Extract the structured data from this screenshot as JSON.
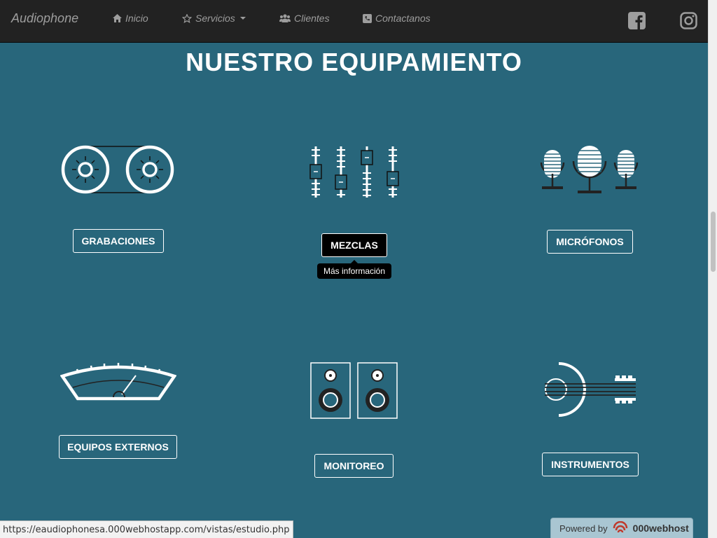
{
  "nav": {
    "brand": "Audiophone",
    "items": [
      {
        "label": "Inicio",
        "icon": "home-icon"
      },
      {
        "label": "Servicios",
        "icon": "star-icon"
      },
      {
        "label": "Clientes",
        "icon": "users-icon"
      },
      {
        "label": "Contactanos",
        "icon": "phone-icon"
      }
    ],
    "social": [
      "facebook-icon",
      "instagram-icon"
    ]
  },
  "page": {
    "title": "NUESTRO EQUIPAMIENTO"
  },
  "equipment": [
    {
      "label": "GRABACIONES",
      "icon": "tape-reel-icon"
    },
    {
      "label": "MEZCLAS",
      "icon": "mixer-faders-icon"
    },
    {
      "label": "MICRÓFONOS",
      "icon": "microphones-icon"
    },
    {
      "label": "EQUIPOS EXTERNOS",
      "icon": "vu-meter-icon"
    },
    {
      "label": "MONITOREO",
      "icon": "speakers-icon"
    },
    {
      "label": "INSTRUMENTOS",
      "icon": "guitar-icon"
    }
  ],
  "tooltip": "Más información",
  "status_url": "https://eaudiophonesa.000webhostapp.com/vistas/estudio.php",
  "powered": {
    "label": "Powered by",
    "host": "000webhost"
  },
  "colors": {
    "background": "#28667b",
    "navbar": "#222222",
    "accent": "#ffffff"
  }
}
